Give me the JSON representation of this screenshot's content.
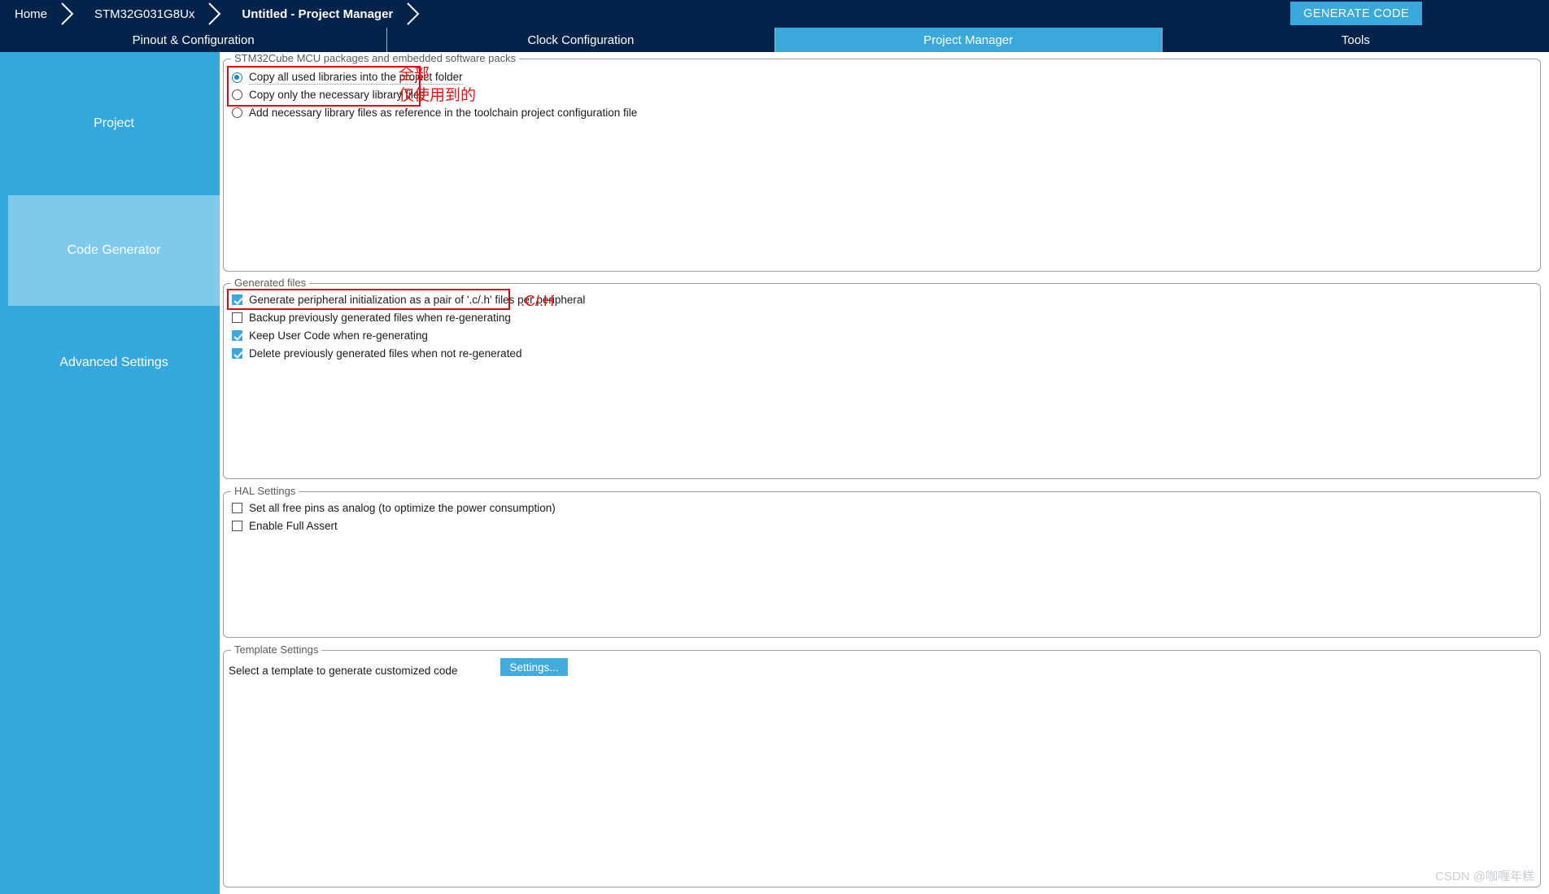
{
  "header": {
    "breadcrumbs": [
      {
        "label": "Home",
        "bold": false
      },
      {
        "label": "STM32G031G8Ux",
        "bold": false
      },
      {
        "label": "Untitled - Project Manager",
        "bold": true
      }
    ],
    "generate_code_label": "GENERATE CODE",
    "bar_color": "#03234b",
    "accent_color": "#39a9dc"
  },
  "tabs": [
    {
      "label": "Pinout & Configuration",
      "active": false
    },
    {
      "label": "Clock Configuration",
      "active": false
    },
    {
      "label": "Project Manager",
      "active": true
    },
    {
      "label": "Tools",
      "active": false
    }
  ],
  "sidebar": {
    "items": [
      {
        "label": "Project",
        "selected": false
      },
      {
        "label": "Code Generator",
        "selected": true
      },
      {
        "label": "Advanced Settings",
        "selected": false
      },
      {
        "label": "",
        "selected": false
      }
    ]
  },
  "groups": {
    "packages": {
      "legend": "STM32Cube MCU packages and embedded software packs",
      "options": [
        {
          "label": "Copy all used libraries into the project folder",
          "checked": true,
          "focused": true
        },
        {
          "label": "Copy only the necessary library files",
          "checked": false,
          "focused": false
        },
        {
          "label": "Add necessary library files as reference in the toolchain project configuration file",
          "checked": false,
          "focused": false
        }
      ]
    },
    "generated_files": {
      "legend": "Generated files",
      "options": [
        {
          "label": "Generate peripheral initialization as a pair of '.c/.h' files per peripheral",
          "checked": true
        },
        {
          "label": "Backup previously generated files when re-generating",
          "checked": false
        },
        {
          "label": "Keep User Code when re-generating",
          "checked": true
        },
        {
          "label": "Delete previously generated files when not re-generated",
          "checked": true
        }
      ]
    },
    "hal_settings": {
      "legend": "HAL Settings",
      "options": [
        {
          "label": "Set all free pins as analog (to optimize the power consumption)",
          "checked": false
        },
        {
          "label": "Enable Full Assert",
          "checked": false
        }
      ]
    },
    "template_settings": {
      "legend": "Template Settings",
      "description": "Select a template to generate customized code",
      "settings_button_label": "Settings..."
    }
  },
  "annotations": {
    "color": "#e8100f",
    "notes": [
      {
        "text": "全部"
      },
      {
        "text": "仅使用到的"
      },
      {
        "text": ".C/.H"
      }
    ]
  },
  "watermark": "CSDN @咖喱年糕"
}
